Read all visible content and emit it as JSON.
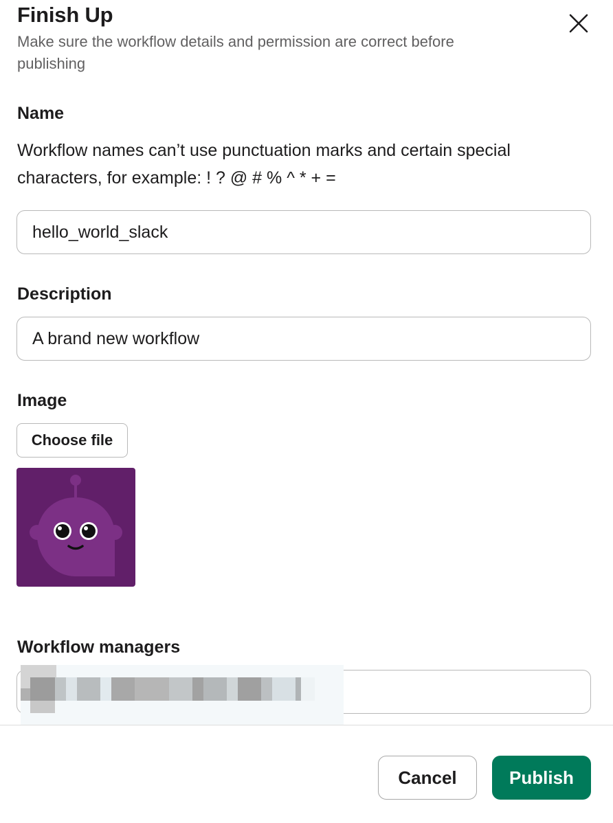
{
  "dialog": {
    "title": "Finish Up",
    "subtitle": "Make sure the workflow details and permission are correct before publishing",
    "close_icon": "close-icon"
  },
  "name_section": {
    "label": "Name",
    "help": "Workflow names can’t use punctuation marks and certain special characters, for example: ! ? @ # % ^ * + =",
    "value": "hello_world_slack"
  },
  "description_section": {
    "label": "Description",
    "value": "A brand new workflow"
  },
  "image_section": {
    "label": "Image",
    "choose_label": "Choose file",
    "preview_icon": "robot-avatar-icon",
    "preview_bg": "#611f69",
    "preview_fg": "#7c3085"
  },
  "managers_section": {
    "label": "Workflow managers"
  },
  "footer": {
    "cancel_label": "Cancel",
    "publish_label": "Publish",
    "publish_color": "#007a5a"
  }
}
